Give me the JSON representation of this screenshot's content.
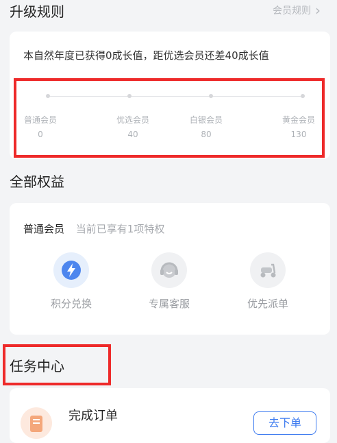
{
  "upgrade": {
    "title": "升级规则",
    "rules_link": "会员规则",
    "description": "本自然年度已获得0成长值，距优选会员还差40成长值",
    "levels": [
      {
        "name": "普通会员",
        "value": "0"
      },
      {
        "name": "优选会员",
        "value": "40"
      },
      {
        "name": "白银会员",
        "value": "80"
      },
      {
        "name": "黄金会员",
        "value": "130"
      }
    ]
  },
  "benefits": {
    "title": "全部权益",
    "tier_name": "普通会员",
    "tier_note": "当前已享有1项特权",
    "perks": [
      {
        "label": "积分兑换",
        "icon": "lightning-icon"
      },
      {
        "label": "专属客服",
        "icon": "headset-icon"
      },
      {
        "label": "优先派单",
        "icon": "scooter-icon"
      }
    ]
  },
  "tasks": {
    "title": "任务中心",
    "items": [
      {
        "title": "完成订单",
        "button": "去下单",
        "icon": "order-icon"
      }
    ]
  },
  "colors": {
    "accent": "#3d7bf0",
    "highlight": "#ee2a2a"
  }
}
